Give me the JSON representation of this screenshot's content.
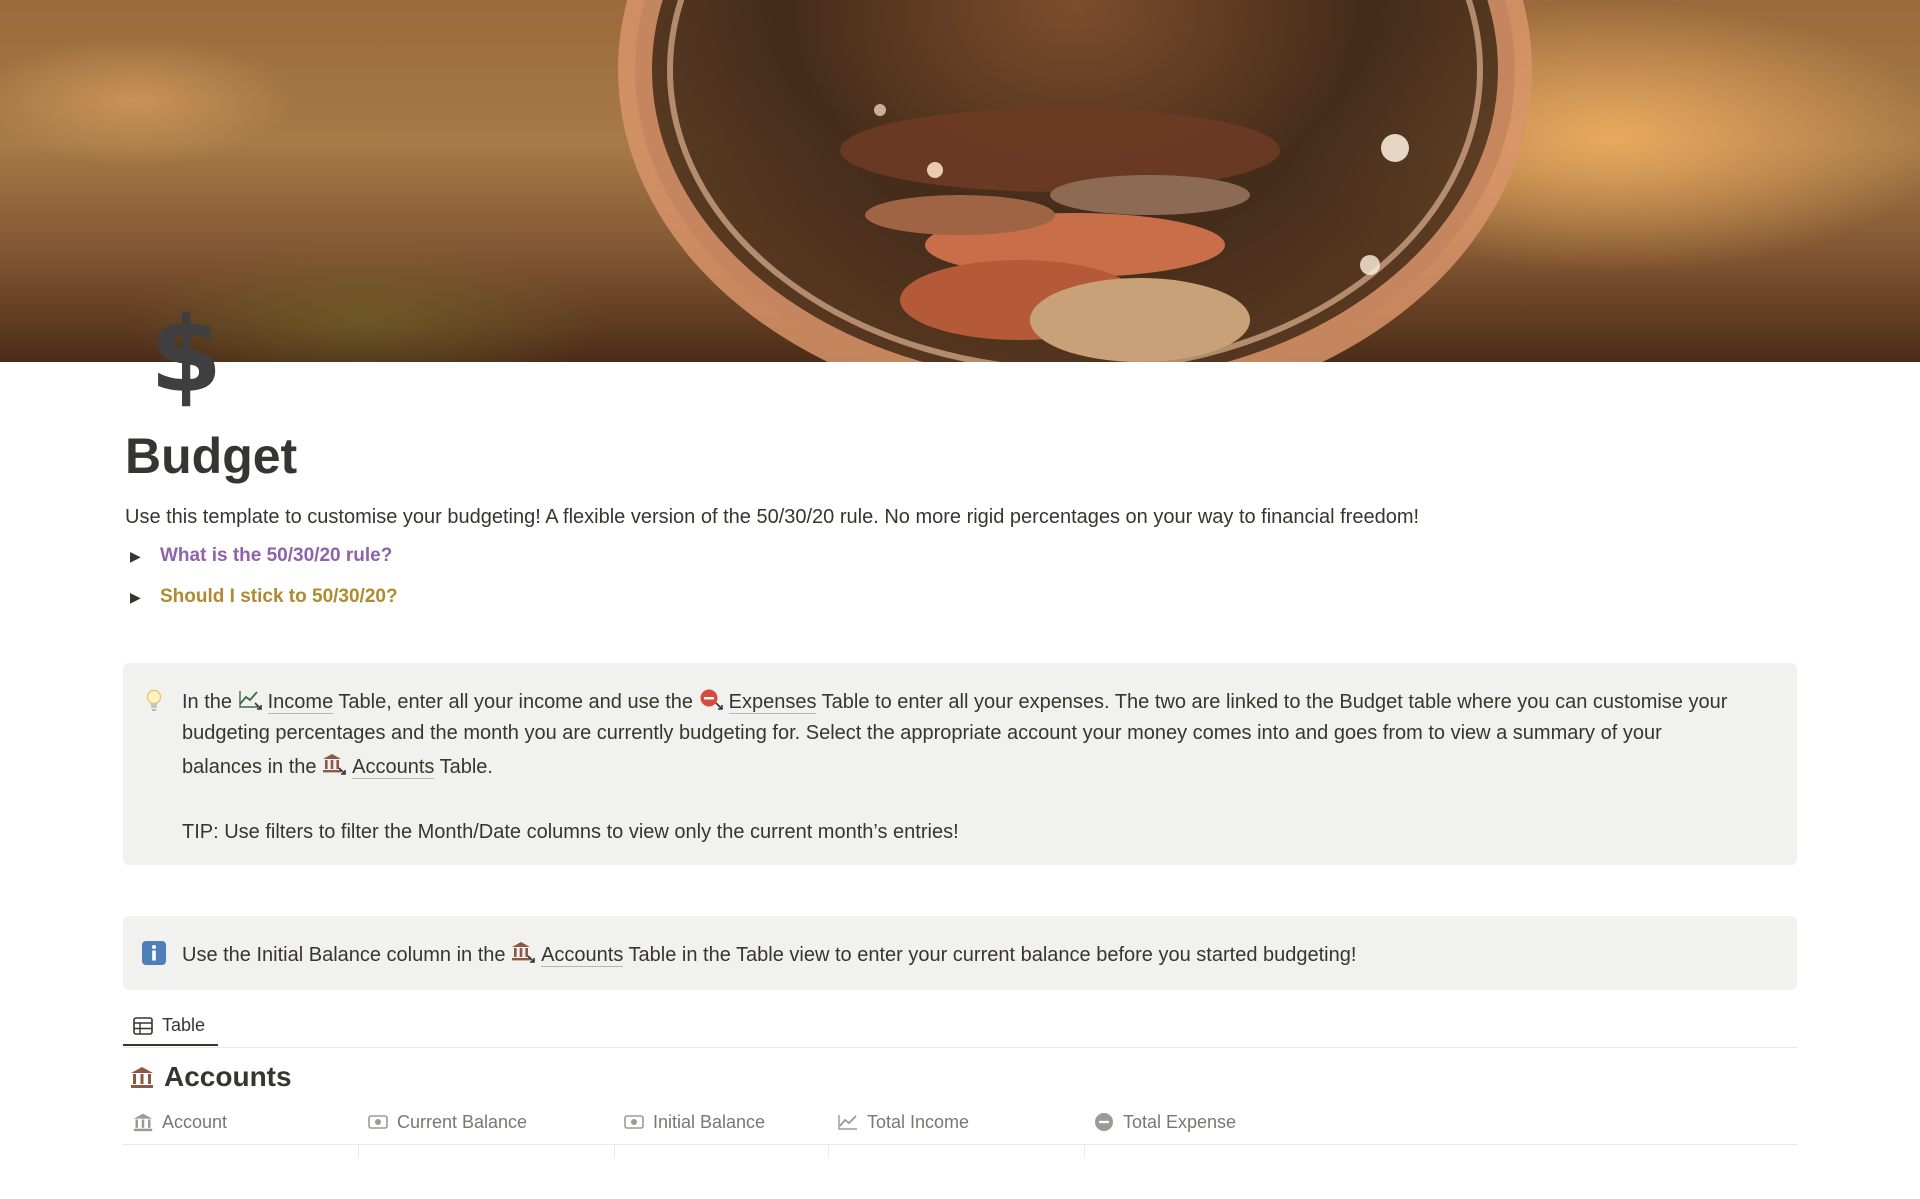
{
  "page": {
    "icon_glyph": "$",
    "title": "Budget",
    "intro": "Use this template to customise your budgeting! A flexible version of the 50/30/20 rule. No more rigid percentages on your way to financial freedom!"
  },
  "toggles": [
    {
      "label": "What is the 50/30/20 rule?",
      "color": "#8e63a8"
    },
    {
      "label": "Should I stick to 50/30/20?",
      "color": "#b08a2e"
    }
  ],
  "callout1": {
    "icon": "lightbulb-icon",
    "p1_a": "In the ",
    "income_label": "Income",
    "p1_b": " Table, enter all your income and use the ",
    "expenses_label": "Expenses",
    "p1_c": " Table to enter all your expenses. The two are linked to the Budget table where you can customise your budgeting percentages and the month you are currently budgeting for.  Select the appropriate account your money comes into and goes from to view a summary of your balances in the ",
    "accounts_label": "Accounts",
    "p1_d": " Table.",
    "tip": "TIP: Use filters to filter the Month/Date columns to view only the current month’s entries!"
  },
  "callout2": {
    "icon": "info-icon",
    "a": "Use the Initial Balance column in the ",
    "accounts_label": "Accounts",
    "b": " Table in the Table view to enter your current balance before you started budgeting!"
  },
  "view_tab": {
    "label": "Table",
    "icon": "table-icon"
  },
  "database": {
    "title": "Accounts",
    "icon": "bank-icon",
    "columns": [
      {
        "label": "Account",
        "icon": "bank-icon"
      },
      {
        "label": "Current Balance",
        "icon": "cash-icon"
      },
      {
        "label": "Initial Balance",
        "icon": "cash-icon"
      },
      {
        "label": "Total Income",
        "icon": "trend-up-icon"
      },
      {
        "label": "Total Expense",
        "icon": "minus-circle-icon"
      }
    ]
  },
  "colors": {
    "callout_bg": "#f1f1ef",
    "text": "#37352f",
    "muted": "#787774"
  }
}
